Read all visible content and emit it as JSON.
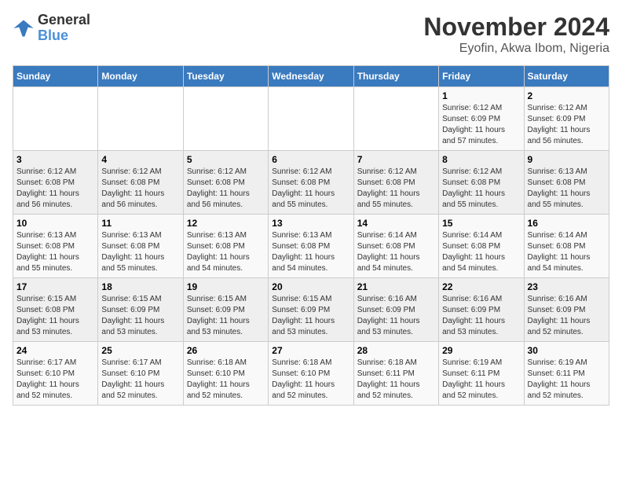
{
  "logo": {
    "line1": "General",
    "line2": "Blue"
  },
  "title": "November 2024",
  "subtitle": "Eyofin, Akwa Ibom, Nigeria",
  "weekdays": [
    "Sunday",
    "Monday",
    "Tuesday",
    "Wednesday",
    "Thursday",
    "Friday",
    "Saturday"
  ],
  "weeks": [
    [
      {
        "day": "",
        "info": ""
      },
      {
        "day": "",
        "info": ""
      },
      {
        "day": "",
        "info": ""
      },
      {
        "day": "",
        "info": ""
      },
      {
        "day": "",
        "info": ""
      },
      {
        "day": "1",
        "info": "Sunrise: 6:12 AM\nSunset: 6:09 PM\nDaylight: 11 hours\nand 57 minutes."
      },
      {
        "day": "2",
        "info": "Sunrise: 6:12 AM\nSunset: 6:09 PM\nDaylight: 11 hours\nand 56 minutes."
      }
    ],
    [
      {
        "day": "3",
        "info": "Sunrise: 6:12 AM\nSunset: 6:08 PM\nDaylight: 11 hours\nand 56 minutes."
      },
      {
        "day": "4",
        "info": "Sunrise: 6:12 AM\nSunset: 6:08 PM\nDaylight: 11 hours\nand 56 minutes."
      },
      {
        "day": "5",
        "info": "Sunrise: 6:12 AM\nSunset: 6:08 PM\nDaylight: 11 hours\nand 56 minutes."
      },
      {
        "day": "6",
        "info": "Sunrise: 6:12 AM\nSunset: 6:08 PM\nDaylight: 11 hours\nand 55 minutes."
      },
      {
        "day": "7",
        "info": "Sunrise: 6:12 AM\nSunset: 6:08 PM\nDaylight: 11 hours\nand 55 minutes."
      },
      {
        "day": "8",
        "info": "Sunrise: 6:12 AM\nSunset: 6:08 PM\nDaylight: 11 hours\nand 55 minutes."
      },
      {
        "day": "9",
        "info": "Sunrise: 6:13 AM\nSunset: 6:08 PM\nDaylight: 11 hours\nand 55 minutes."
      }
    ],
    [
      {
        "day": "10",
        "info": "Sunrise: 6:13 AM\nSunset: 6:08 PM\nDaylight: 11 hours\nand 55 minutes."
      },
      {
        "day": "11",
        "info": "Sunrise: 6:13 AM\nSunset: 6:08 PM\nDaylight: 11 hours\nand 55 minutes."
      },
      {
        "day": "12",
        "info": "Sunrise: 6:13 AM\nSunset: 6:08 PM\nDaylight: 11 hours\nand 54 minutes."
      },
      {
        "day": "13",
        "info": "Sunrise: 6:13 AM\nSunset: 6:08 PM\nDaylight: 11 hours\nand 54 minutes."
      },
      {
        "day": "14",
        "info": "Sunrise: 6:14 AM\nSunset: 6:08 PM\nDaylight: 11 hours\nand 54 minutes."
      },
      {
        "day": "15",
        "info": "Sunrise: 6:14 AM\nSunset: 6:08 PM\nDaylight: 11 hours\nand 54 minutes."
      },
      {
        "day": "16",
        "info": "Sunrise: 6:14 AM\nSunset: 6:08 PM\nDaylight: 11 hours\nand 54 minutes."
      }
    ],
    [
      {
        "day": "17",
        "info": "Sunrise: 6:15 AM\nSunset: 6:08 PM\nDaylight: 11 hours\nand 53 minutes."
      },
      {
        "day": "18",
        "info": "Sunrise: 6:15 AM\nSunset: 6:09 PM\nDaylight: 11 hours\nand 53 minutes."
      },
      {
        "day": "19",
        "info": "Sunrise: 6:15 AM\nSunset: 6:09 PM\nDaylight: 11 hours\nand 53 minutes."
      },
      {
        "day": "20",
        "info": "Sunrise: 6:15 AM\nSunset: 6:09 PM\nDaylight: 11 hours\nand 53 minutes."
      },
      {
        "day": "21",
        "info": "Sunrise: 6:16 AM\nSunset: 6:09 PM\nDaylight: 11 hours\nand 53 minutes."
      },
      {
        "day": "22",
        "info": "Sunrise: 6:16 AM\nSunset: 6:09 PM\nDaylight: 11 hours\nand 53 minutes."
      },
      {
        "day": "23",
        "info": "Sunrise: 6:16 AM\nSunset: 6:09 PM\nDaylight: 11 hours\nand 52 minutes."
      }
    ],
    [
      {
        "day": "24",
        "info": "Sunrise: 6:17 AM\nSunset: 6:10 PM\nDaylight: 11 hours\nand 52 minutes."
      },
      {
        "day": "25",
        "info": "Sunrise: 6:17 AM\nSunset: 6:10 PM\nDaylight: 11 hours\nand 52 minutes."
      },
      {
        "day": "26",
        "info": "Sunrise: 6:18 AM\nSunset: 6:10 PM\nDaylight: 11 hours\nand 52 minutes."
      },
      {
        "day": "27",
        "info": "Sunrise: 6:18 AM\nSunset: 6:10 PM\nDaylight: 11 hours\nand 52 minutes."
      },
      {
        "day": "28",
        "info": "Sunrise: 6:18 AM\nSunset: 6:11 PM\nDaylight: 11 hours\nand 52 minutes."
      },
      {
        "day": "29",
        "info": "Sunrise: 6:19 AM\nSunset: 6:11 PM\nDaylight: 11 hours\nand 52 minutes."
      },
      {
        "day": "30",
        "info": "Sunrise: 6:19 AM\nSunset: 6:11 PM\nDaylight: 11 hours\nand 52 minutes."
      }
    ]
  ]
}
